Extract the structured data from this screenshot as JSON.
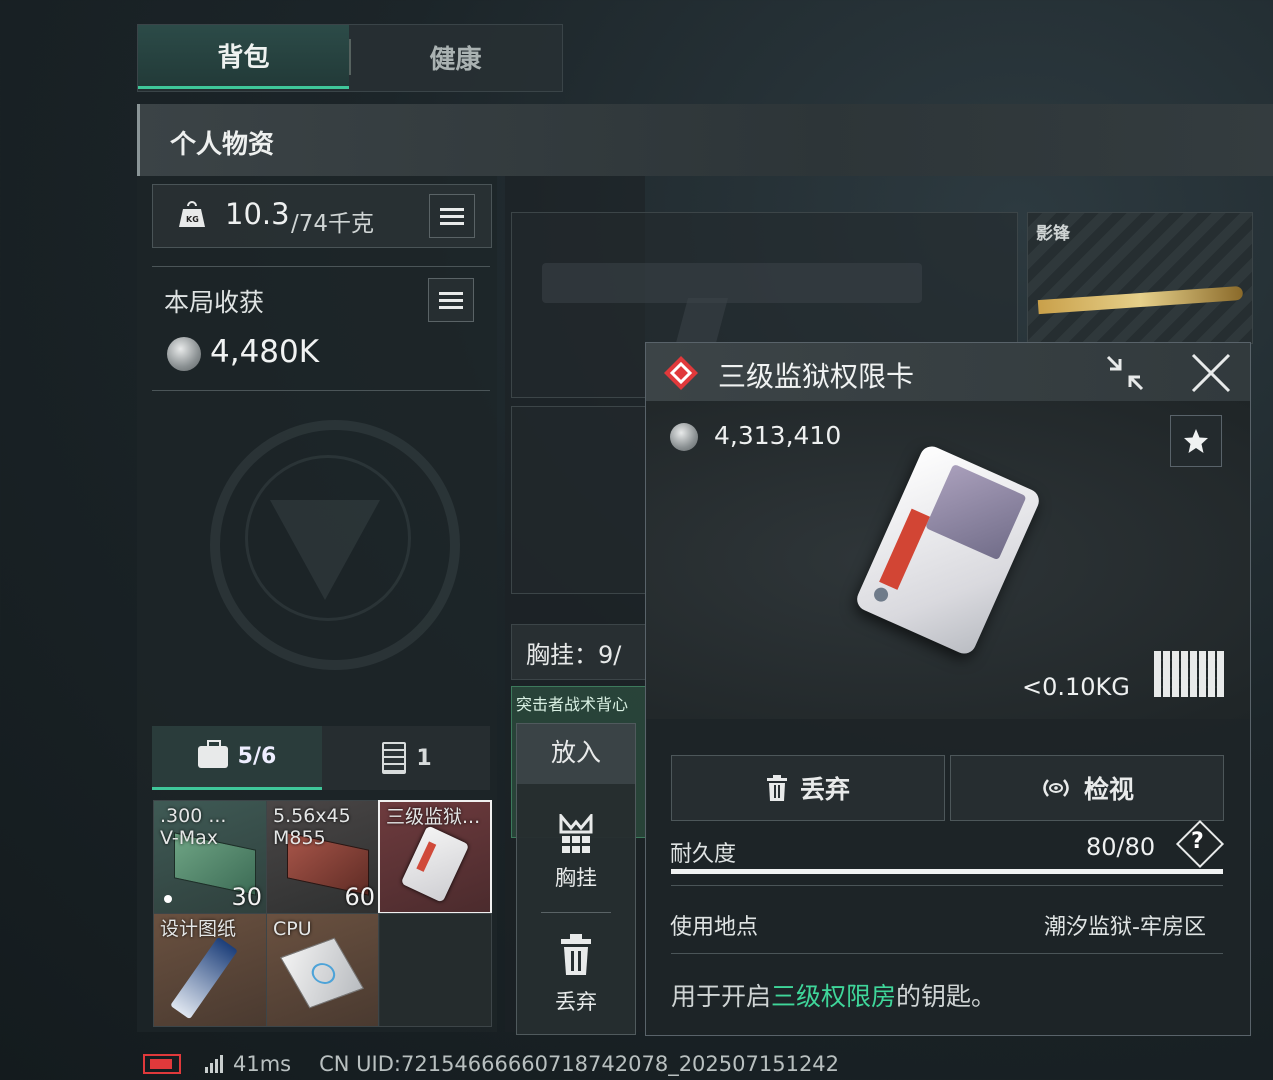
{
  "tabs": {
    "backpack": "背包",
    "health": "健康"
  },
  "section": {
    "title": "个人物资"
  },
  "weight": {
    "current": "10.3",
    "max": "/74千克",
    "kg_badge": "KG"
  },
  "loot": {
    "title": "本局收获",
    "value": "4,480K"
  },
  "inventory": {
    "tab1_label": "5/6",
    "tab2_label": "1",
    "slots": [
      {
        "label": ".300 ...\nV-Max",
        "count": "30",
        "color": "#3b6b55"
      },
      {
        "label": "5.56x45\nM855",
        "count": "60",
        "color": "#6a3b34"
      },
      {
        "label": "三级监狱...",
        "count": "",
        "color": "#6b3a3c"
      },
      {
        "label": "设计图纸",
        "count": "",
        "color": "#6a5140"
      },
      {
        "label": "CPU",
        "count": "",
        "color": "#6a5140"
      }
    ]
  },
  "middle": {
    "weapon_label": "影锋",
    "vest_label": "胸挂：9/",
    "bag_label": "突击者战术背心"
  },
  "context_menu": {
    "put_in": "放入",
    "vest": "胸挂",
    "discard": "丢弃"
  },
  "popup": {
    "title": "三级监狱权限卡",
    "price": "4,313,410",
    "weight": "<0.10KG",
    "discard_label": "丢弃",
    "inspect_label": "检视",
    "durability_label": "耐久度",
    "durability_value": "80/80",
    "durability_fraction": 1.0,
    "location_label": "使用地点",
    "location_value": "潮汐监狱-牢房区",
    "desc_prefix": "用于开启",
    "desc_highlight": "三级权限房",
    "desc_suffix": "的钥匙。",
    "help_glyph": "?",
    "highlight_color": "#3fd69a",
    "accent_color": "#e0393b"
  },
  "status": {
    "ping": "41ms",
    "uid": "CN UID:72154666660718742078_202507151242"
  }
}
